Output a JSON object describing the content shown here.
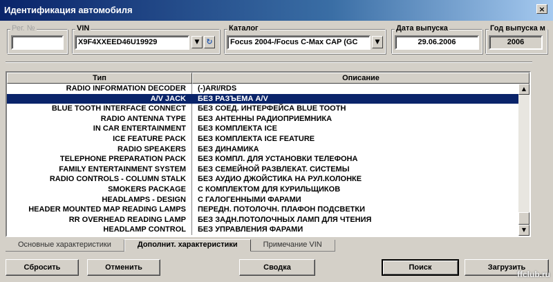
{
  "window": {
    "title": "Идентификация автомобиля",
    "close_label": "×"
  },
  "fields": {
    "reg": {
      "label": "Рег. №",
      "value": ""
    },
    "vin": {
      "label": "VIN",
      "value": "X9F4XXEED46U19929"
    },
    "catalog": {
      "label": "Каталог",
      "value": "Focus 2004-/Focus C-Max CAP (GC"
    },
    "release_date": {
      "label": "Дата выпуска",
      "value": "29.06.2006"
    },
    "release_year": {
      "label": "Год выпуска м",
      "value": "2006"
    }
  },
  "grid": {
    "columns": [
      "Тип",
      "Описание"
    ],
    "rows": [
      [
        "RADIO INFORMATION DECODER",
        "(-)ARI/RDS"
      ],
      [
        "A/V JACK",
        "БЕЗ РАЗЪЕМА A/V"
      ],
      [
        "BLUE TOOTH INTERFACE CONNECT",
        "БЕЗ СОЕД. ИНТЕРФЕЙСА BLUE TOOTH"
      ],
      [
        "RADIO ANTENNA TYPE",
        "БЕЗ АНТЕННЫ РАДИОПРИЕМНИКА"
      ],
      [
        "IN CAR ENTERTAINMENT",
        "БЕЗ КОМПЛЕКТА ICE"
      ],
      [
        "ICE FEATURE PACK",
        "БЕЗ КОМПЛЕКТА ICE FEATURE"
      ],
      [
        "RADIO SPEAKERS",
        "БЕЗ ДИНАМИКА"
      ],
      [
        "TELEPHONE PREPARATION PACK",
        "БЕЗ КОМПЛ. ДЛЯ УСТАНОВКИ ТЕЛЕФОНА"
      ],
      [
        "FAMILY ENTERTAINMENT SYSTEM",
        "БЕЗ СЕМЕЙНОЙ РАЗВЛЕКАТ. СИСТЕМЫ"
      ],
      [
        "RADIO CONTROLS - COLUMN STALK",
        "БЕЗ АУДИО ДЖОЙСТИКА НА РУЛ.КОЛОНКЕ"
      ],
      [
        "SMOKERS PACKAGE",
        "С КОМПЛЕКТОМ ДЛЯ КУРИЛЬЩИКОВ"
      ],
      [
        "HEADLAMPS - DESIGN",
        "С ГАЛОГЕННЫМИ ФАРАМИ"
      ],
      [
        "HEADER MOUNTED MAP READING LAMPS",
        "ПЕРЕДН. ПОТОЛОЧН. ПЛАФОН ПОДСВЕТКИ"
      ],
      [
        "RR OVERHEAD READING LAMP",
        "БЕЗ ЗАДН.ПОТОЛОЧНЫХ ЛАМП ДЛЯ ЧТЕНИЯ"
      ],
      [
        "HEADLAMP CONTROL",
        "БЕЗ УПРАВЛЕНИЯ ФАРАМИ"
      ]
    ],
    "selected_row": 1
  },
  "tabs": [
    {
      "label": "Основные характеристики",
      "active": false
    },
    {
      "label": "Дополнит. характеристики",
      "active": true
    },
    {
      "label": "Примечание VIN",
      "active": false
    }
  ],
  "buttons": {
    "reset": "Сбросить",
    "cancel": "Отменить",
    "summary": "Сводка",
    "search": "Поиск",
    "load": "Загрузить"
  },
  "watermark": "ffclub.ru",
  "colors": {
    "selection": "#0a246a",
    "title_start": "#0a246a",
    "face": "#d4d0c8"
  }
}
